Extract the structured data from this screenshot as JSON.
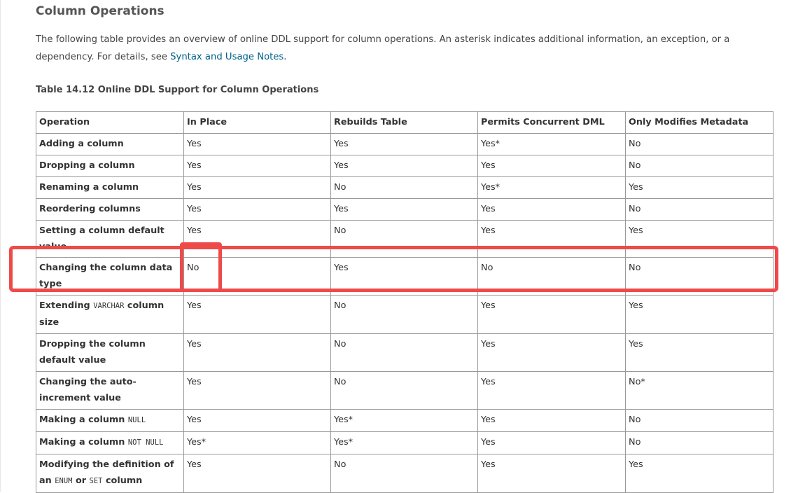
{
  "section_title": "Column Operations",
  "intro": {
    "text_before_link": "The following table provides an overview of online DDL support for column operations. An asterisk indicates additional information, an exception, or a dependency. For details, see ",
    "link_text": "Syntax and Usage Notes",
    "text_after_link": "."
  },
  "table_caption": "Table 14.12 Online DDL Support for Column Operations",
  "columns": [
    "Operation",
    "In Place",
    "Rebuilds Table",
    "Permits Concurrent DML",
    "Only Modifies Metadata"
  ],
  "rows": [
    {
      "op": "Adding a column",
      "in_place": "Yes",
      "rebuilds": "Yes",
      "concurrent": "Yes*",
      "metadata": "No"
    },
    {
      "op": "Dropping a column",
      "in_place": "Yes",
      "rebuilds": "Yes",
      "concurrent": "Yes",
      "metadata": "No"
    },
    {
      "op": "Renaming a column",
      "in_place": "Yes",
      "rebuilds": "No",
      "concurrent": "Yes*",
      "metadata": "Yes"
    },
    {
      "op": "Reordering columns",
      "in_place": "Yes",
      "rebuilds": "Yes",
      "concurrent": "Yes",
      "metadata": "No"
    },
    {
      "op": "Setting a column default value",
      "in_place": "Yes",
      "rebuilds": "No",
      "concurrent": "Yes",
      "metadata": "Yes"
    },
    {
      "op": "Changing the column data type",
      "in_place": "No",
      "rebuilds": "Yes",
      "concurrent": "No",
      "metadata": "No"
    },
    {
      "op_pre": "Extending ",
      "op_code": "VARCHAR",
      "op_post": " column size",
      "in_place": "Yes",
      "rebuilds": "No",
      "concurrent": "Yes",
      "metadata": "Yes"
    },
    {
      "op": "Dropping the column default value",
      "in_place": "Yes",
      "rebuilds": "No",
      "concurrent": "Yes",
      "metadata": "Yes"
    },
    {
      "op": "Changing the auto-increment value",
      "in_place": "Yes",
      "rebuilds": "No",
      "concurrent": "Yes",
      "metadata": "No*"
    },
    {
      "op_pre": "Making a column ",
      "op_code": "NULL",
      "in_place": "Yes",
      "rebuilds": "Yes*",
      "concurrent": "Yes",
      "metadata": "No"
    },
    {
      "op_pre": "Making a column ",
      "op_code": "NOT NULL",
      "in_place": "Yes*",
      "rebuilds": "Yes*",
      "concurrent": "Yes",
      "metadata": "No"
    },
    {
      "op_pre": "Modifying the definition of an ",
      "op_code": "ENUM",
      "op_mid": " or ",
      "op_code2": "SET",
      "op_post": " column",
      "in_place": "Yes",
      "rebuilds": "No",
      "concurrent": "Yes",
      "metadata": "Yes"
    }
  ],
  "colors": {
    "highlight": "#ef4a4a",
    "link": "#00618a",
    "border": "#999999"
  }
}
